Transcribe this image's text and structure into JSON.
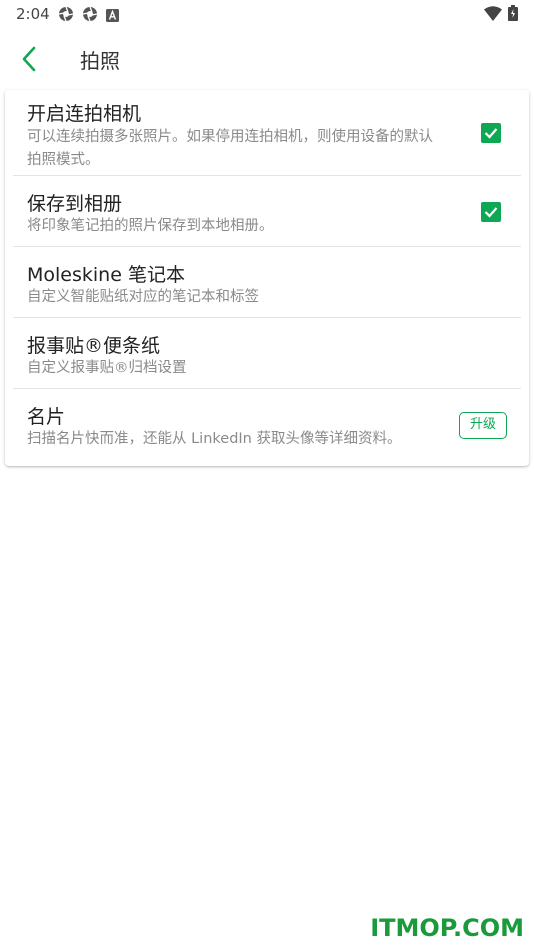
{
  "status_bar": {
    "time": "2:04",
    "left_icons": [
      "aperture-icon",
      "aperture-icon",
      "a-box-icon"
    ],
    "right_icons": [
      "wifi-icon",
      "battery-icon"
    ]
  },
  "app_bar": {
    "title": "拍照",
    "back_icon": "chevron-left-icon"
  },
  "settings": [
    {
      "title": "开启连拍相机",
      "subtitle_lines": [
        "可以连续拍摄多张照片。如果停用连拍相机，则使用设备的默认",
        "拍照模式。"
      ],
      "control": "checkbox",
      "checked": true
    },
    {
      "title": "保存到相册",
      "subtitle_lines": [
        "将印象笔记拍的照片保存到本地相册。"
      ],
      "control": "checkbox",
      "checked": true
    },
    {
      "title": "Moleskine 笔记本",
      "subtitle_lines": [
        "自定义智能贴纸对应的笔记本和标签"
      ],
      "control": "none"
    },
    {
      "title": "报事贴®便条纸",
      "subtitle_lines": [
        "自定义报事贴®归档设置"
      ],
      "control": "none"
    },
    {
      "title": "名片",
      "subtitle_lines": [
        "扫描名片快而准，还能从 LinkedIn 获取头像等详细资料。"
      ],
      "control": "badge",
      "badge_label": "升级"
    }
  ],
  "colors": {
    "accent": "#0ea854",
    "watermark": "#1a9a3b"
  },
  "watermark": "ITMOP.COM"
}
